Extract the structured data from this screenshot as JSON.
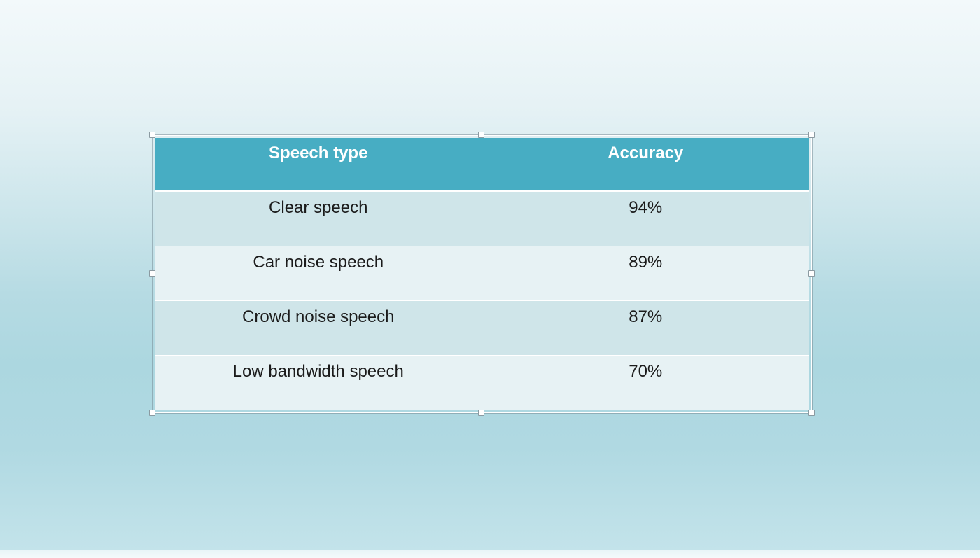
{
  "table": {
    "headers": [
      "Speech type",
      "Accuracy"
    ],
    "rows": [
      [
        "Clear speech",
        "94%"
      ],
      [
        "Car noise speech",
        "89%"
      ],
      [
        "Crowd noise speech",
        "87%"
      ],
      [
        "Low bandwidth speech",
        "70%"
      ]
    ]
  },
  "colors": {
    "header_background": "#47adc3",
    "header_text": "#ffffff",
    "row_band_dark": "#cfe5e9",
    "row_band_light": "#e7f2f4",
    "slide_background_top": "#f3f9fb",
    "slide_background_bottom": "#acd7e0"
  },
  "selection": {
    "selected": true
  }
}
